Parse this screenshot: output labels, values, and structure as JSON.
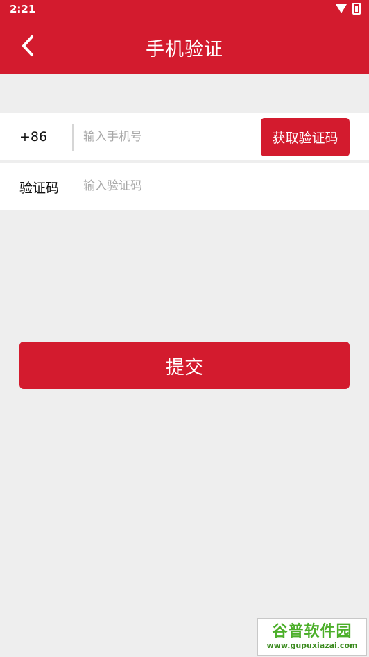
{
  "status_bar": {
    "time": "2:21"
  },
  "header": {
    "title": "手机验证"
  },
  "phone_row": {
    "country_code": "+86",
    "phone_placeholder": "输入手机号",
    "get_code_label": "获取验证码"
  },
  "code_row": {
    "label": "验证码",
    "code_placeholder": "输入验证码"
  },
  "submit_label": "提交",
  "watermark": {
    "title": "谷普软件园",
    "url": "www.gupuxiazai.com"
  },
  "colors": {
    "accent": "#d31b2e",
    "background": "#eeeeee"
  }
}
